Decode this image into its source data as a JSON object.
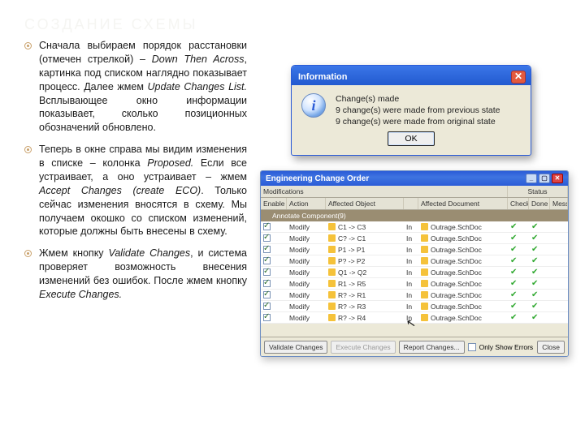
{
  "heading": "СОЗДАНИЕ СХЕМЫ",
  "bullets": [
    "Сначала выбираем порядок расстановки (отмечен стрелкой) – <em>Down Then Across</em>, картинка под списком наглядно показывает процесс. Далее жмем <em>Update Changes List.</em> Всплывающее окно информации показывает, сколько позиционных обозначений обновлено.",
    "Теперь в окне справа мы видим изменения в списке – колонка <em>Proposed.</em> Если все устраивает, а оно устраивает – жмем <em>Accept Changes (create ECO)</em>. Только сейчас изменения вносятся в схему. Мы получаем окошко со списком изменений, которые должны быть внесены в схему.",
    "Жмем кнопку <em>Validate Changes</em>, и система проверяет возможность внесения изменений без ошибок. После жмем кнопку <em>Execute Changes.</em>"
  ],
  "info": {
    "title": "Information",
    "heading": "Change(s) made",
    "line1": "9 change(s) were made from previous state",
    "line2": "9 change(s) were made from original state",
    "ok": "OK"
  },
  "eco": {
    "title": "Engineering Change Order",
    "modsLabel": "Modifications",
    "statusLabel": "Status",
    "cols": [
      "Enable",
      "Action",
      "Affected Object",
      "",
      "Affected Document",
      "Check",
      "Done",
      "Message"
    ],
    "group": "Annotate Component(9)",
    "rows": [
      {
        "obj": "C1 -> C3",
        "doc": "Outrage.SchDoc"
      },
      {
        "obj": "C? -> C1",
        "doc": "Outrage.SchDoc"
      },
      {
        "obj": "P1 -> P1",
        "doc": "Outrage.SchDoc"
      },
      {
        "obj": "P? -> P2",
        "doc": "Outrage.SchDoc"
      },
      {
        "obj": "Q1 -> Q2",
        "doc": "Outrage.SchDoc"
      },
      {
        "obj": "R1 -> R5",
        "doc": "Outrage.SchDoc"
      },
      {
        "obj": "R? -> R1",
        "doc": "Outrage.SchDoc"
      },
      {
        "obj": "R? -> R3",
        "doc": "Outrage.SchDoc"
      },
      {
        "obj": "R? -> R4",
        "doc": "Outrage.SchDoc"
      }
    ],
    "action": "Modify",
    "in": "In",
    "buttons": {
      "validate": "Validate Changes",
      "execute": "Execute Changes",
      "report": "Report Changes...",
      "only": "Only Show Errors",
      "close": "Close"
    }
  }
}
